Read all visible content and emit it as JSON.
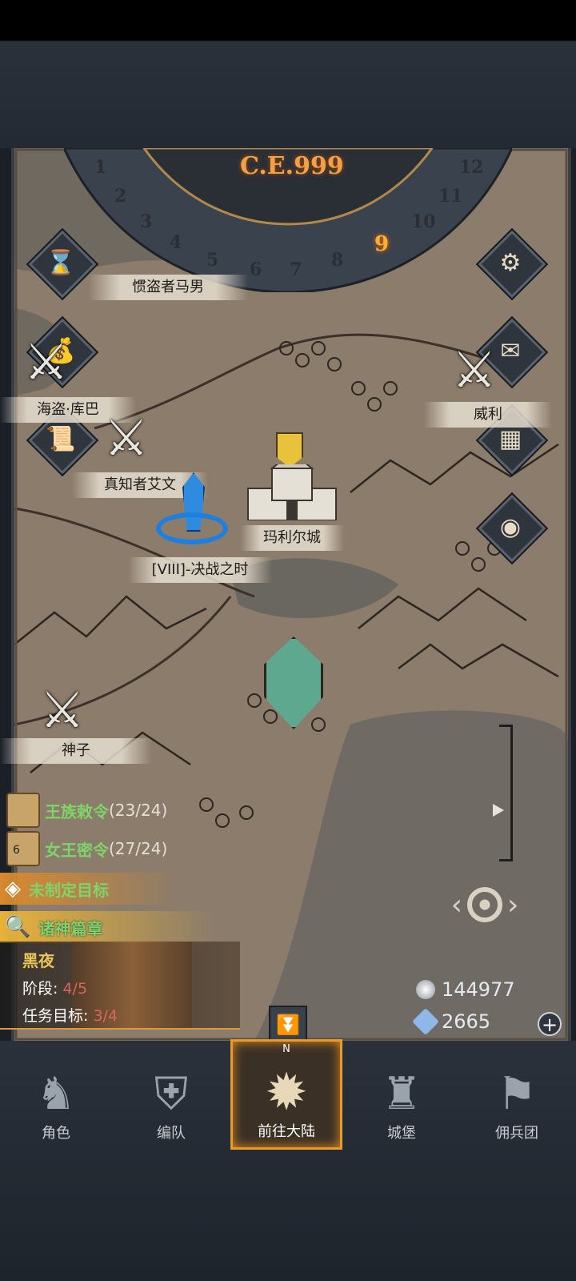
{
  "calendar": {
    "era": "C.E.999",
    "months": [
      "1",
      "2",
      "3",
      "4",
      "5",
      "6",
      "7",
      "8",
      "9",
      "10",
      "11",
      "12"
    ],
    "current_month": "9"
  },
  "map": {
    "labels": {
      "thief": "惯盗者马男",
      "pirate": "海盗·库巴",
      "wise": "真知者艾文",
      "weili": "威利",
      "castle": "玛利尔城",
      "battle": "[VIII]-决战之时",
      "shenzi": "神子"
    }
  },
  "quests": {
    "royal": {
      "title": "王族敕令",
      "progress": "(23/24)"
    },
    "queen": {
      "title": "女王密令",
      "progress": "(27/24)",
      "badge": "6"
    },
    "goal": {
      "title": "未制定目标"
    },
    "chapter": {
      "title": "诸神篇章"
    }
  },
  "story": {
    "name": "黑夜",
    "stage_label": "阶段:",
    "stage_value": "4/5",
    "task_label": "任务目标:",
    "task_value": "3/4"
  },
  "resources": {
    "silver": "144977",
    "crystal": "2665"
  },
  "compass_letter": "N",
  "tabs": [
    {
      "label": "角色",
      "icon": "knight-icon"
    },
    {
      "label": "编队",
      "icon": "helmet-icon"
    },
    {
      "label": "前往大陆",
      "icon": "compass-icon"
    },
    {
      "label": "城堡",
      "icon": "castle-icon"
    },
    {
      "label": "佣兵团",
      "icon": "mercenary-icon"
    }
  ],
  "colors": {
    "quest_green": "#7fd36a",
    "accent_orange": "#f0a24a",
    "progress_red": "#d9665e",
    "story_yellow": "#e8c45a",
    "map_parchment": "#8a7b6a"
  }
}
